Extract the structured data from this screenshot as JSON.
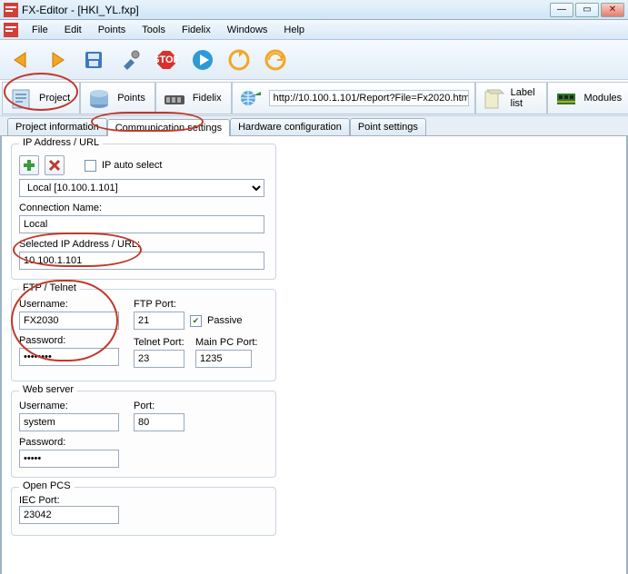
{
  "window": {
    "title": "FX-Editor - [HKI_YL.fxp]"
  },
  "menu": [
    "File",
    "Edit",
    "Points",
    "Tools",
    "Fidelix",
    "Windows",
    "Help"
  ],
  "toolbar_icons": [
    "back-icon",
    "forward-icon",
    "save-icon",
    "tools-icon",
    "stop-icon",
    "play-icon",
    "refresh-icon",
    "sync-icon"
  ],
  "nav": {
    "project": "Project",
    "points": "Points",
    "fidelix": "Fidelix",
    "url": "http://10.100.1.101/Report?File=Fx2020.htm",
    "labellist": "Label list",
    "modules": "Modules"
  },
  "subtabs": {
    "project_info": "Project information",
    "comm_settings": "Communication settings",
    "hw_config": "Hardware configuration",
    "point_settings": "Point settings"
  },
  "ipgroup": {
    "legend": "IP Address / URL",
    "autoselect": "IP auto select",
    "dropdown": "Local [10.100.1.101]",
    "conn_name_label": "Connection Name:",
    "conn_name": "Local",
    "sel_ip_label": "Selected IP Address / URL:",
    "sel_ip": "10.100.1.101"
  },
  "ftp": {
    "legend": "FTP / Telnet",
    "username_label": "Username:",
    "username": "FX2030",
    "password_label": "Password:",
    "password": "••••••••",
    "ftpport_label": "FTP Port:",
    "ftpport": "21",
    "passive_label": "Passive",
    "telnet_label": "Telnet Port:",
    "telnet": "23",
    "mainpc_label": "Main PC Port:",
    "mainpc": "1235"
  },
  "web": {
    "legend": "Web server",
    "username_label": "Username:",
    "username": "system",
    "port_label": "Port:",
    "port": "80",
    "password_label": "Password:",
    "password": "•••••"
  },
  "pcs": {
    "legend": "Open PCS",
    "iec_label": "IEC Port:",
    "iec": "23042"
  }
}
